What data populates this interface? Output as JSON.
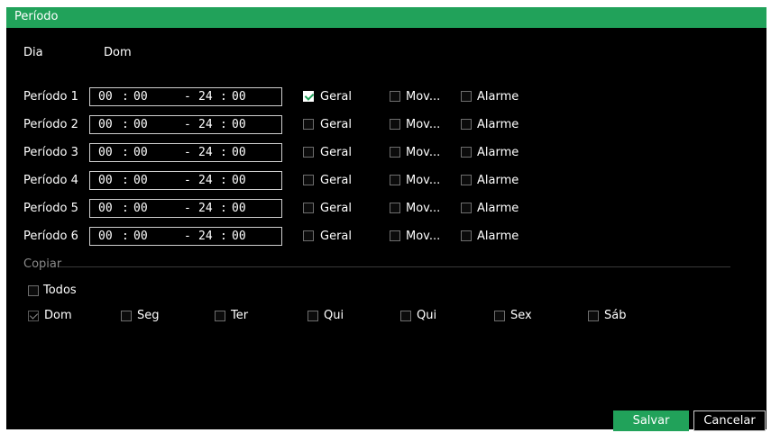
{
  "title": "Período",
  "day": {
    "label": "Dia",
    "value": "Dom"
  },
  "periods": [
    {
      "label": "Período 1",
      "start_h": "00",
      "start_m": "00",
      "end_h": "24",
      "end_m": "00",
      "geral": true,
      "mov": false,
      "alarme": false
    },
    {
      "label": "Período 2",
      "start_h": "00",
      "start_m": "00",
      "end_h": "24",
      "end_m": "00",
      "geral": false,
      "mov": false,
      "alarme": false
    },
    {
      "label": "Período 3",
      "start_h": "00",
      "start_m": "00",
      "end_h": "24",
      "end_m": "00",
      "geral": false,
      "mov": false,
      "alarme": false
    },
    {
      "label": "Período 4",
      "start_h": "00",
      "start_m": "00",
      "end_h": "24",
      "end_m": "00",
      "geral": false,
      "mov": false,
      "alarme": false
    },
    {
      "label": "Período 5",
      "start_h": "00",
      "start_m": "00",
      "end_h": "24",
      "end_m": "00",
      "geral": false,
      "mov": false,
      "alarme": false
    },
    {
      "label": "Período 6",
      "start_h": "00",
      "start_m": "00",
      "end_h": "24",
      "end_m": "00",
      "geral": false,
      "mov": false,
      "alarme": false
    }
  ],
  "event_labels": {
    "geral": "Geral",
    "mov": "Mov...",
    "alarme": "Alarme"
  },
  "time_sep": ":",
  "range_sep": "-",
  "copy": {
    "label": "Copiar",
    "all_label": "Todos",
    "days": [
      {
        "label": "Dom",
        "checked": true,
        "disabled": true
      },
      {
        "label": "Seg",
        "checked": false
      },
      {
        "label": "Ter",
        "checked": false
      },
      {
        "label": "Qui",
        "checked": false
      },
      {
        "label": "Qui",
        "checked": false
      },
      {
        "label": "Sex",
        "checked": false
      },
      {
        "label": "Sáb",
        "checked": false
      }
    ]
  },
  "buttons": {
    "save": "Salvar",
    "cancel": "Cancelar"
  },
  "colors": {
    "accent": "#21a25a",
    "background": "#000000",
    "text": "#ffffff"
  }
}
